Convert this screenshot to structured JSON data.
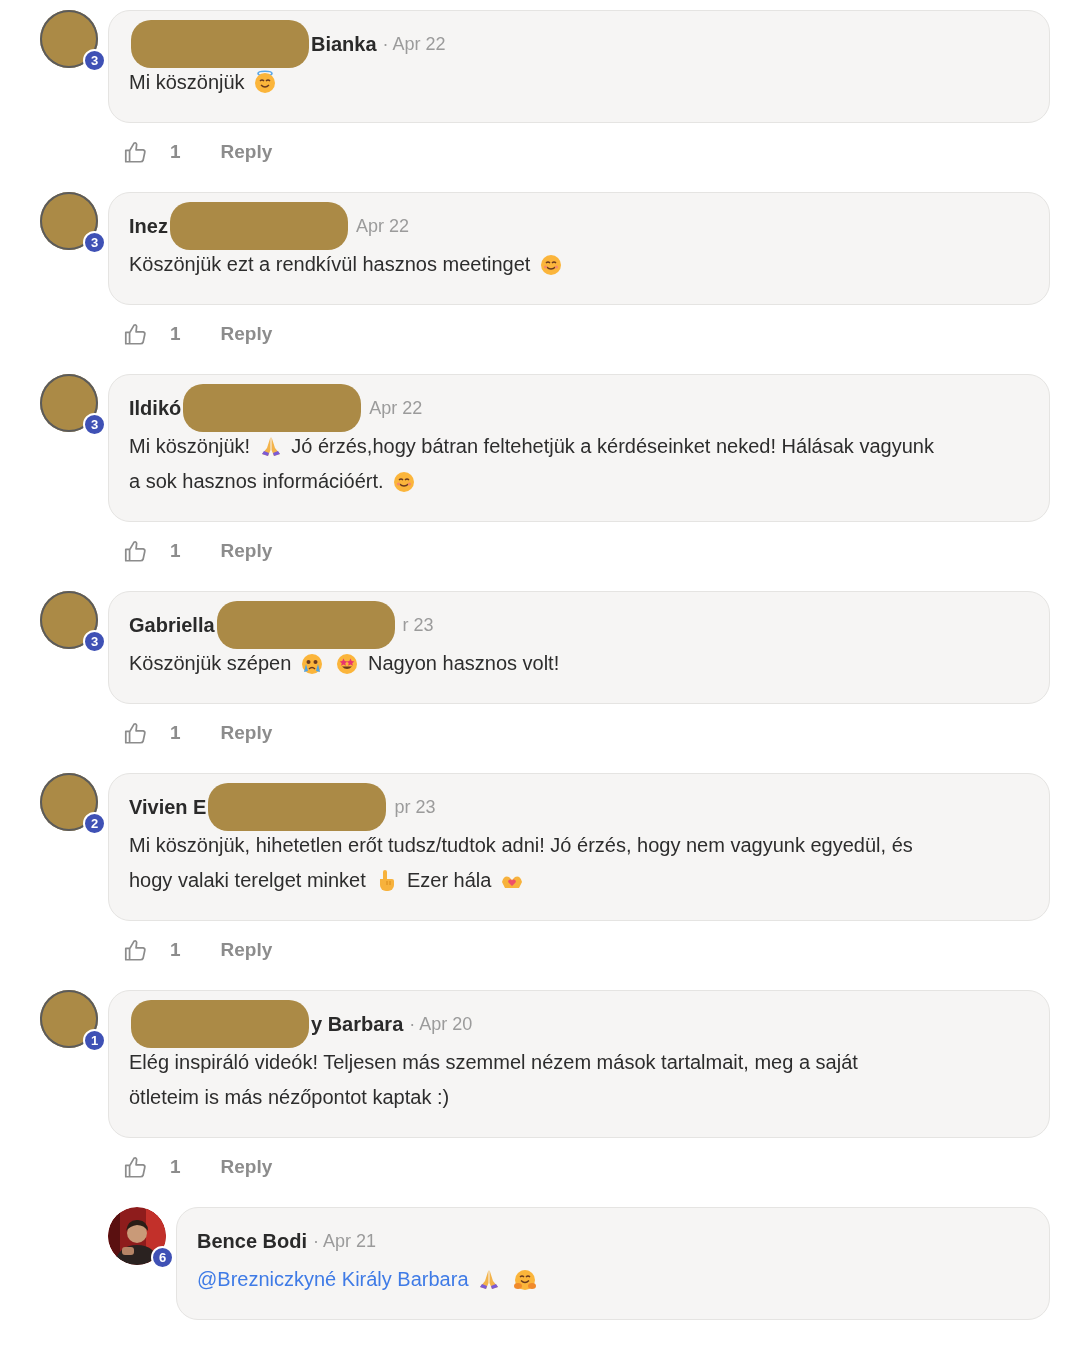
{
  "comments": [
    {
      "avatar": {
        "kind": "redacted",
        "badge": "3"
      },
      "header": [
        {
          "kind": "redaction"
        },
        {
          "kind": "name",
          "text": "Bianka"
        },
        {
          "kind": "date",
          "text": "· Apr 22"
        }
      ],
      "lines": [
        [
          {
            "kind": "text",
            "text": "Mi köszönjük"
          },
          {
            "kind": "angel"
          }
        ]
      ],
      "likes": "1",
      "reply": "Reply"
    },
    {
      "avatar": {
        "kind": "redacted",
        "badge": "3"
      },
      "header": [
        {
          "kind": "name",
          "text": "Inez"
        },
        {
          "kind": "redaction"
        },
        {
          "kind": "date",
          "text": "Apr 22"
        }
      ],
      "lines": [
        [
          {
            "kind": "text",
            "text": "Köszönjük ezt a rendkívül hasznos meetinget"
          },
          {
            "kind": "smile"
          }
        ]
      ],
      "likes": "1",
      "reply": "Reply"
    },
    {
      "avatar": {
        "kind": "redacted",
        "badge": "3"
      },
      "header": [
        {
          "kind": "name",
          "text": "Ildikó"
        },
        {
          "kind": "redaction"
        },
        {
          "kind": "date",
          "text": "Apr 22"
        }
      ],
      "lines": [
        [
          {
            "kind": "text",
            "text": "Mi köszönjük!"
          },
          {
            "kind": "pray"
          },
          {
            "kind": "text",
            "text": "Jó érzés,hogy bátran feltehetjük a kérdéseinket neked! Hálásak vagyunk"
          }
        ],
        [
          {
            "kind": "text",
            "text": "a sok hasznos információért."
          },
          {
            "kind": "smile"
          }
        ]
      ],
      "likes": "1",
      "reply": "Reply"
    },
    {
      "avatar": {
        "kind": "redacted",
        "badge": "3"
      },
      "header": [
        {
          "kind": "name",
          "text": "Gabriella"
        },
        {
          "kind": "redaction"
        },
        {
          "kind": "date",
          "text": "r 23"
        }
      ],
      "lines": [
        [
          {
            "kind": "text",
            "text": "Köszönjük szépen"
          },
          {
            "kind": "cry"
          },
          {
            "kind": "stareyes"
          },
          {
            "kind": "text",
            "text": "Nagyon hasznos volt!"
          }
        ]
      ],
      "likes": "1",
      "reply": "Reply"
    },
    {
      "avatar": {
        "kind": "redacted",
        "badge": "2"
      },
      "header": [
        {
          "kind": "name",
          "text": "Vivien E"
        },
        {
          "kind": "redaction"
        },
        {
          "kind": "date",
          "text": "pr 23"
        }
      ],
      "lines": [
        [
          {
            "kind": "text",
            "text": "Mi köszönjük, hihetetlen erőt tudsz/tudtok adni! Jó érzés, hogy nem vagyunk egyedül, és"
          }
        ],
        [
          {
            "kind": "text",
            "text": "hogy valaki terelget minket"
          },
          {
            "kind": "point"
          },
          {
            "kind": "text",
            "text": "Ezer hála"
          },
          {
            "kind": "hearthands"
          }
        ]
      ],
      "likes": "1",
      "reply": "Reply"
    },
    {
      "avatar": {
        "kind": "redacted",
        "badge": "1"
      },
      "header": [
        {
          "kind": "redaction"
        },
        {
          "kind": "name",
          "text": "y Barbara"
        },
        {
          "kind": "date",
          "text": "· Apr 20"
        }
      ],
      "lines": [
        [
          {
            "kind": "text",
            "text": "Elég inspiráló videók! Teljesen más szemmel nézem mások tartalmait, meg a saját"
          }
        ],
        [
          {
            "kind": "text",
            "text": "ötleteim is más nézőpontot kaptak :)"
          }
        ]
      ],
      "likes": "1",
      "reply": "Reply",
      "replies": [
        {
          "avatar": {
            "kind": "picture",
            "badge": "6"
          },
          "header": [
            {
              "kind": "name",
              "text": "Bence Bodi"
            },
            {
              "kind": "date",
              "text": "· Apr 21"
            }
          ],
          "lines": [
            [
              {
                "kind": "mention",
                "text": "@Brezniczkyné Király Barbara"
              },
              {
                "kind": "pray"
              },
              {
                "kind": "hug"
              }
            ]
          ]
        }
      ]
    }
  ]
}
